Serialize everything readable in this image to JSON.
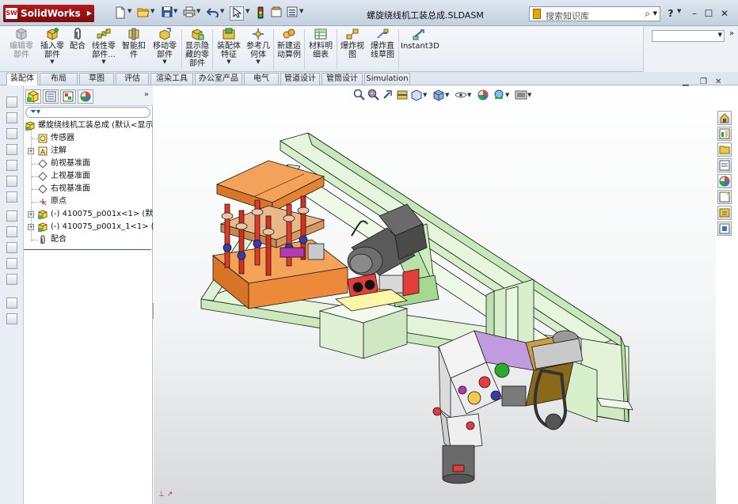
{
  "app": {
    "name": "SolidWorks",
    "document_title": "螺旋绕线机工装总成.SLDASM",
    "search_placeholder": "搜索知识库",
    "help_label": "?"
  },
  "ribbon": {
    "buttons": [
      {
        "id": "edit-component",
        "label": "编辑零\n部件",
        "dropdown": false,
        "disabled": true
      },
      {
        "id": "insert-component",
        "label": "插入零\n部件",
        "dropdown": true,
        "disabled": false
      },
      {
        "id": "mate",
        "label": "配合",
        "dropdown": false,
        "disabled": false
      },
      {
        "id": "linear-pattern",
        "label": "线性零\n部件...",
        "dropdown": true,
        "disabled": false
      },
      {
        "id": "smart-fasteners",
        "label": "智能扣\n件",
        "dropdown": false,
        "disabled": false
      },
      {
        "id": "move-component",
        "label": "移动零\n部件",
        "dropdown": true,
        "disabled": false
      },
      {
        "id": "show-hidden",
        "label": "显示隐\n藏的零\n部件",
        "dropdown": false,
        "disabled": false
      },
      {
        "id": "assembly-feature",
        "label": "装配体\n特征",
        "dropdown": true,
        "disabled": false
      },
      {
        "id": "reference-geometry",
        "label": "参考几\n何体",
        "dropdown": true,
        "disabled": false
      },
      {
        "id": "new-motion-study",
        "label": "新建运\n动算例",
        "dropdown": false,
        "disabled": false
      },
      {
        "id": "bill-of-materials",
        "label": "材料明\n细表",
        "dropdown": false,
        "disabled": false
      },
      {
        "id": "exploded-view",
        "label": "爆炸视\n图",
        "dropdown": false,
        "disabled": false
      },
      {
        "id": "explode-line-sketch",
        "label": "爆炸直\n线草图",
        "dropdown": false,
        "disabled": false
      },
      {
        "id": "instant3d",
        "label": "Instant3D",
        "dropdown": false,
        "disabled": false
      }
    ]
  },
  "tabs": [
    {
      "label": "装配体",
      "active": true
    },
    {
      "label": "布局",
      "active": false
    },
    {
      "label": "草图",
      "active": false
    },
    {
      "label": "评估",
      "active": false
    },
    {
      "label": "渲染工具",
      "active": false
    },
    {
      "label": "办公室产品",
      "active": false
    },
    {
      "label": "电气",
      "active": false
    },
    {
      "label": "管道设计",
      "active": false
    },
    {
      "label": "管筒设计",
      "active": false
    },
    {
      "label": "Simulation",
      "active": false
    }
  ],
  "feature_tree": {
    "more_label": "»",
    "root": "螺旋绕线机工装总成  (默认<显示",
    "items": [
      {
        "label": "传感器",
        "icon": "sensor-icon",
        "expandable": false
      },
      {
        "label": "注解",
        "icon": "annotation-icon",
        "expandable": true
      },
      {
        "label": "前视基准面",
        "icon": "plane-icon",
        "expandable": false
      },
      {
        "label": "上视基准面",
        "icon": "plane-icon",
        "expandable": false
      },
      {
        "label": "右视基准面",
        "icon": "plane-icon",
        "expandable": false
      },
      {
        "label": "原点",
        "icon": "origin-icon",
        "expandable": false
      },
      {
        "label": "(-) 410075_p001x<1> (默认",
        "icon": "part-icon",
        "expandable": true
      },
      {
        "label": "(-) 410075_p001x_1<1> (默",
        "icon": "part-icon",
        "expandable": true
      },
      {
        "label": "配合",
        "icon": "mates-icon",
        "expandable": false
      }
    ]
  },
  "colors": {
    "accent": "#2a5bb0",
    "fixture_orange": "#f08a2c",
    "frame_green": "#dff3d6",
    "link_red": "#d43b2a"
  }
}
